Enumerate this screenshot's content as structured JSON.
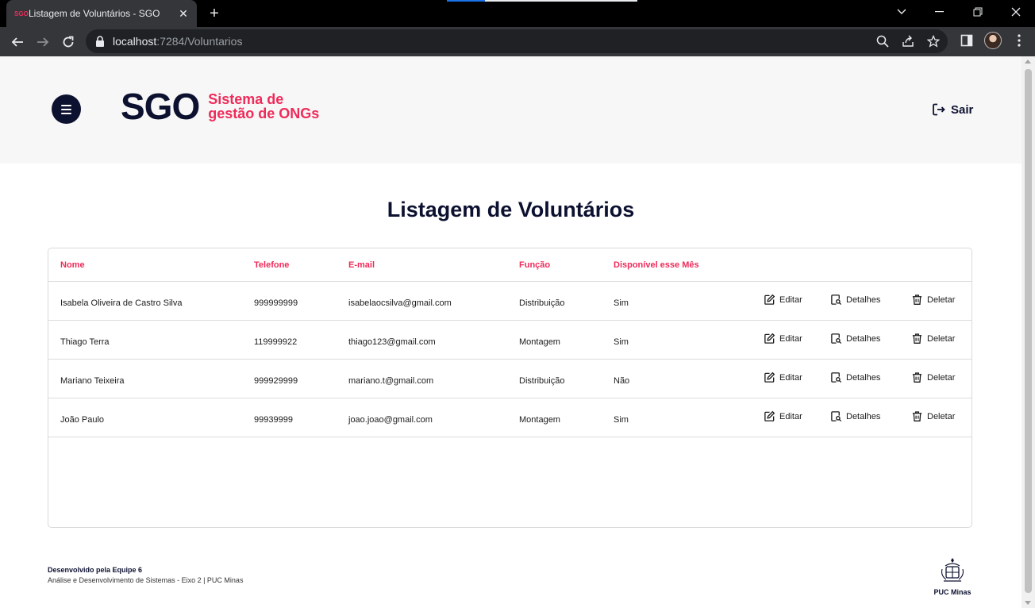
{
  "browser": {
    "tab_title": "Listagem de Voluntários - SGO",
    "favicon_text": "SGO",
    "url_host": "localhost",
    "url_path": ":7284/Voluntarios"
  },
  "header": {
    "logo_mark": "SGO",
    "logo_line1": "Sistema de",
    "logo_line2": "gestão de ONGs",
    "logout_label": "Sair"
  },
  "page_title": "Listagem de Voluntários",
  "table": {
    "columns": {
      "nome": "Nome",
      "telefone": "Telefone",
      "email": "E-mail",
      "funcao": "Função",
      "disponivel": "Disponível esse Mês"
    },
    "rows": [
      {
        "nome": "Isabela Oliveira de Castro Silva",
        "telefone": "999999999",
        "email": "isabelaocsilva@gmail.com",
        "funcao": "Distribuição",
        "disponivel": "Sim"
      },
      {
        "nome": "Thiago Terra",
        "telefone": "119999922",
        "email": "thiago123@gmail.com",
        "funcao": "Montagem",
        "disponivel": "Sim"
      },
      {
        "nome": "Mariano Teixeira",
        "telefone": "999929999",
        "email": "mariano.t@gmail.com",
        "funcao": "Distribuição",
        "disponivel": "Não"
      },
      {
        "nome": "João Paulo",
        "telefone": "99939999",
        "email": "joao.joao@gmail.com",
        "funcao": "Montagem",
        "disponivel": "Sim"
      }
    ],
    "actions": {
      "edit": "Editar",
      "details": "Detalhes",
      "delete": "Deletar"
    }
  },
  "footer": {
    "title": "Desenvolvido pela Equipe 6",
    "subtitle": "Análise e Desenvolvimento de Sistemas - Eixo 2 | PUC Minas",
    "institution_logo_text": "PUC Minas"
  },
  "colors": {
    "brand_navy": "#0d1130",
    "brand_pink": "#ef2b5a"
  }
}
